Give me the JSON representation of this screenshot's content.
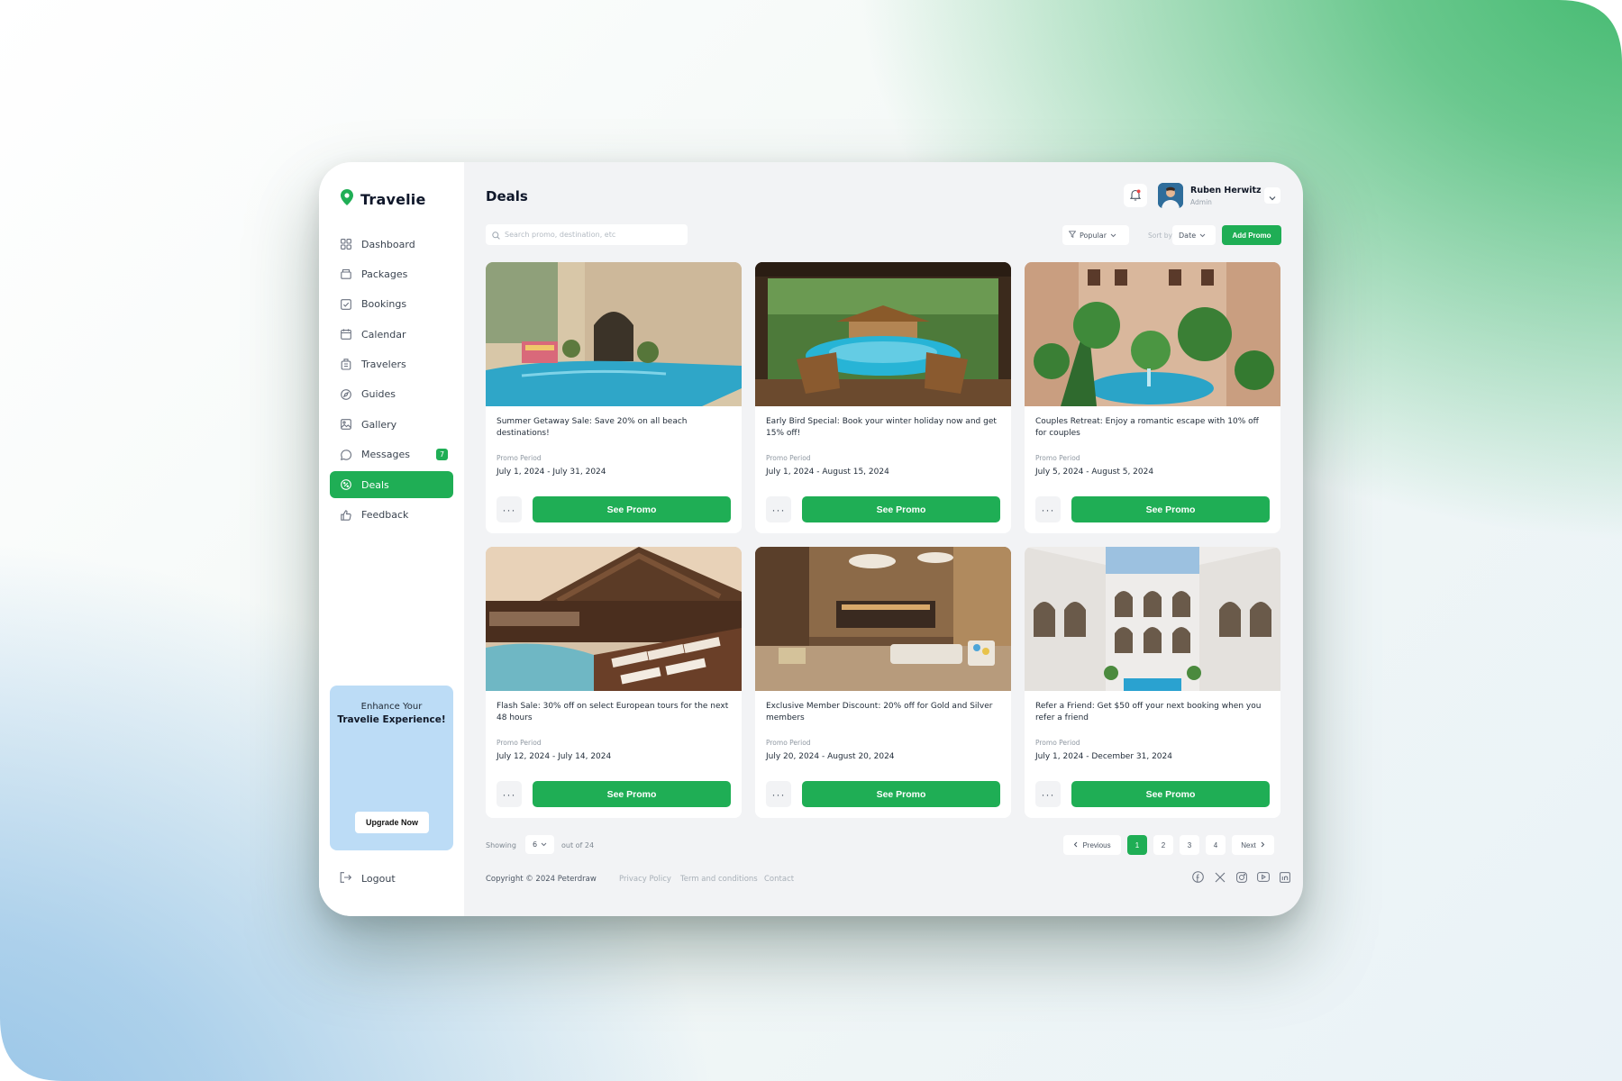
{
  "brand": {
    "name": "Travelie",
    "accent": "#1fae55"
  },
  "sidebar": {
    "items": [
      {
        "label": "Dashboard",
        "icon": "grid-icon"
      },
      {
        "label": "Packages",
        "icon": "package-icon"
      },
      {
        "label": "Bookings",
        "icon": "check-square-icon"
      },
      {
        "label": "Calendar",
        "icon": "calendar-icon"
      },
      {
        "label": "Travelers",
        "icon": "luggage-icon"
      },
      {
        "label": "Guides",
        "icon": "compass-icon"
      },
      {
        "label": "Gallery",
        "icon": "image-icon"
      },
      {
        "label": "Messages",
        "icon": "chat-icon",
        "badge": "7"
      },
      {
        "label": "Deals",
        "icon": "discount-icon",
        "active": true
      },
      {
        "label": "Feedback",
        "icon": "thumbs-up-icon"
      }
    ],
    "promo": {
      "line1": "Enhance Your",
      "line2": "Travelie Experience!",
      "button": "Upgrade Now"
    },
    "logout": "Logout"
  },
  "header": {
    "title": "Deals",
    "user": {
      "name": "Ruben Herwitz",
      "role": "Admin"
    }
  },
  "toolbar": {
    "search_placeholder": "Search promo, destination, etc",
    "filter": "Popular",
    "sort_label": "Sort by:",
    "sort_value": "Date",
    "add_button": "Add Promo"
  },
  "deals": [
    {
      "text": "Summer Getaway Sale: Save 20% on all beach destinations!",
      "period_label": "Promo Period",
      "period": "July 1, 2024 - July 31, 2024",
      "button": "See Promo",
      "more": "···"
    },
    {
      "text": "Early Bird Special: Book your winter holiday now and get 15% off!",
      "period_label": "Promo Period",
      "period": "July 1, 2024 - August 15, 2024",
      "button": "See Promo",
      "more": "···"
    },
    {
      "text": "Couples Retreat: Enjoy a romantic escape with 10% off for couples",
      "period_label": "Promo Period",
      "period": "July 5, 2024 - August 5, 2024",
      "button": "See Promo",
      "more": "···"
    },
    {
      "text": "Flash Sale: 30% off on select European tours for the next 48 hours",
      "period_label": "Promo Period",
      "period": "July 12, 2024 - July 14, 2024",
      "button": "See Promo",
      "more": "···"
    },
    {
      "text": "Exclusive Member Discount: 20% off for Gold and Silver members",
      "period_label": "Promo Period",
      "period": "July 20, 2024 - August 20, 2024",
      "button": "See Promo",
      "more": "···"
    },
    {
      "text": "Refer a Friend: Get $50 off your next booking when you refer a friend",
      "period_label": "Promo Period",
      "period": "July 1, 2024 - December 31, 2024",
      "button": "See Promo",
      "more": "···"
    }
  ],
  "pagination": {
    "showing": "Showing",
    "per_page": "6",
    "out_of": "out of 24",
    "previous": "Previous",
    "pages": [
      "1",
      "2",
      "3",
      "4"
    ],
    "current": "1",
    "next": "Next"
  },
  "footer": {
    "copyright": "Copyright © 2024 Peterdraw",
    "links": [
      "Privacy Policy",
      "Term and conditions",
      "Contact"
    ],
    "social": [
      "facebook-icon",
      "x-icon",
      "instagram-icon",
      "youtube-icon",
      "linkedin-icon"
    ]
  }
}
